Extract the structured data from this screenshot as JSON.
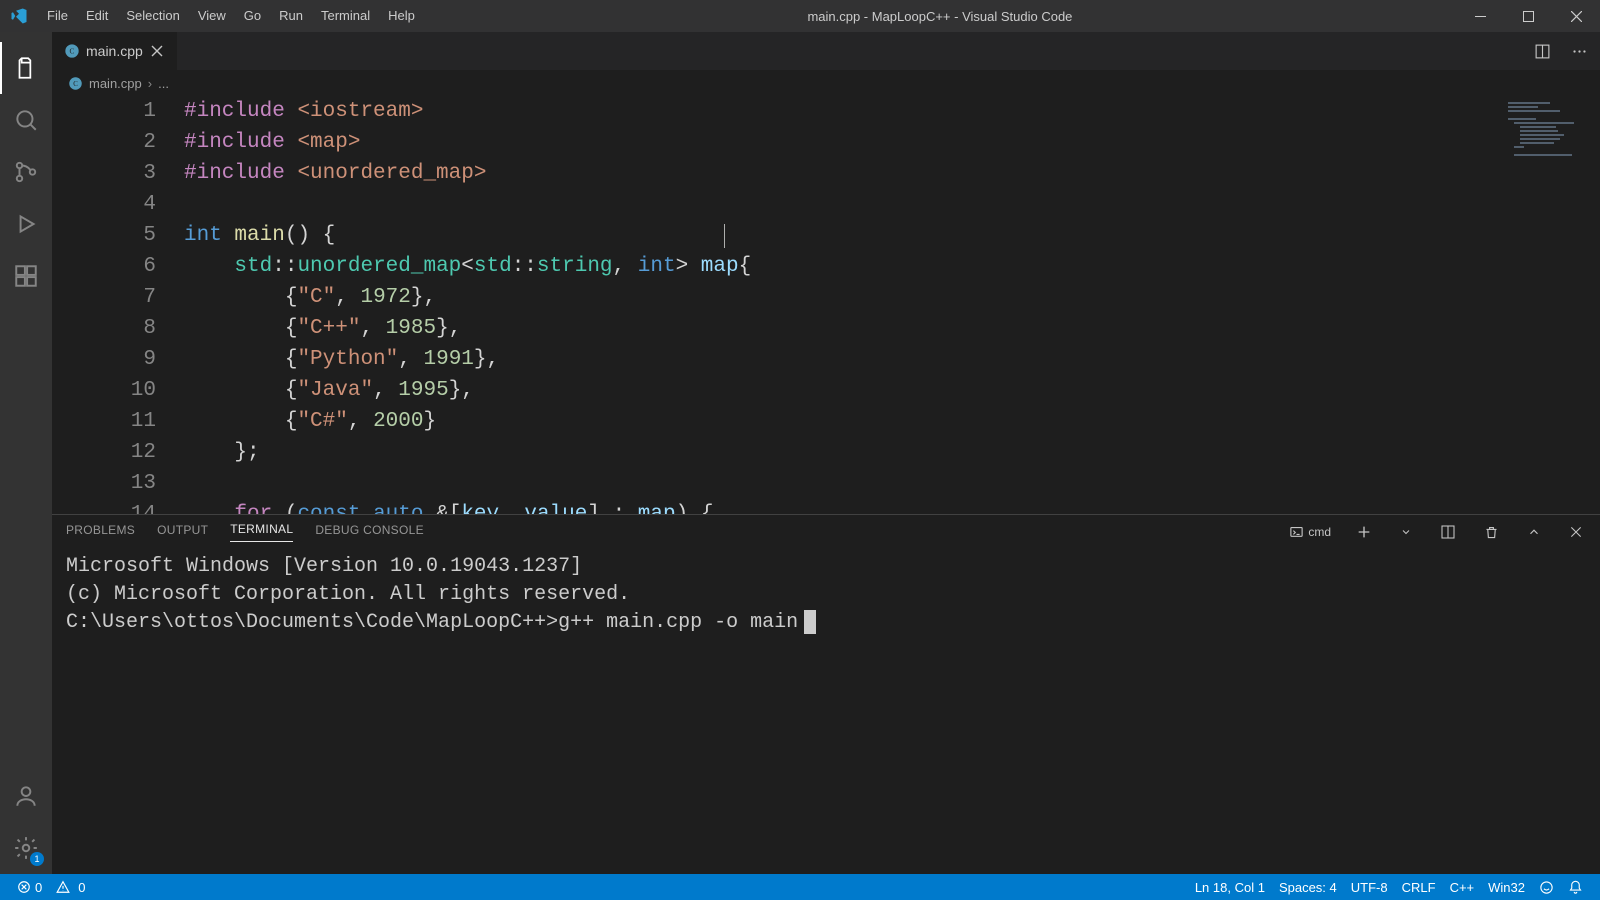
{
  "menu": [
    "File",
    "Edit",
    "Selection",
    "View",
    "Go",
    "Run",
    "Terminal",
    "Help"
  ],
  "title": "main.cpp - MapLoopC++ - Visual Studio Code",
  "tab": {
    "label": "main.cpp"
  },
  "breadcrumb": {
    "file": "main.cpp",
    "more": "..."
  },
  "code_lines": 14,
  "code": [
    [
      {
        "cls": "tok-directive",
        "t": "#include"
      },
      {
        "cls": "tok-plain",
        "t": " "
      },
      {
        "cls": "tok-angled",
        "t": "<iostream>"
      }
    ],
    [
      {
        "cls": "tok-directive",
        "t": "#include"
      },
      {
        "cls": "tok-plain",
        "t": " "
      },
      {
        "cls": "tok-angled",
        "t": "<map>"
      }
    ],
    [
      {
        "cls": "tok-directive",
        "t": "#include"
      },
      {
        "cls": "tok-plain",
        "t": " "
      },
      {
        "cls": "tok-angled",
        "t": "<unordered_map>"
      }
    ],
    [],
    [
      {
        "cls": "tok-type",
        "t": "int"
      },
      {
        "cls": "tok-plain",
        "t": " "
      },
      {
        "cls": "tok-func",
        "t": "main"
      },
      {
        "cls": "tok-punct",
        "t": "() {"
      }
    ],
    [
      {
        "cls": "tok-plain",
        "t": "    "
      },
      {
        "cls": "tok-ns",
        "t": "std"
      },
      {
        "cls": "tok-punct",
        "t": "::"
      },
      {
        "cls": "tok-ns",
        "t": "unordered_map"
      },
      {
        "cls": "tok-punct",
        "t": "<"
      },
      {
        "cls": "tok-ns",
        "t": "std"
      },
      {
        "cls": "tok-punct",
        "t": "::"
      },
      {
        "cls": "tok-ns",
        "t": "string"
      },
      {
        "cls": "tok-punct",
        "t": ", "
      },
      {
        "cls": "tok-type",
        "t": "int"
      },
      {
        "cls": "tok-punct",
        "t": "> "
      },
      {
        "cls": "tok-var",
        "t": "map"
      },
      {
        "cls": "tok-punct",
        "t": "{"
      }
    ],
    [
      {
        "cls": "tok-plain",
        "t": "        "
      },
      {
        "cls": "tok-punct",
        "t": "{"
      },
      {
        "cls": "tok-string",
        "t": "\"C\""
      },
      {
        "cls": "tok-punct",
        "t": ", "
      },
      {
        "cls": "tok-number",
        "t": "1972"
      },
      {
        "cls": "tok-punct",
        "t": "},"
      }
    ],
    [
      {
        "cls": "tok-plain",
        "t": "        "
      },
      {
        "cls": "tok-punct",
        "t": "{"
      },
      {
        "cls": "tok-string",
        "t": "\"C++\""
      },
      {
        "cls": "tok-punct",
        "t": ", "
      },
      {
        "cls": "tok-number",
        "t": "1985"
      },
      {
        "cls": "tok-punct",
        "t": "},"
      }
    ],
    [
      {
        "cls": "tok-plain",
        "t": "        "
      },
      {
        "cls": "tok-punct",
        "t": "{"
      },
      {
        "cls": "tok-string",
        "t": "\"Python\""
      },
      {
        "cls": "tok-punct",
        "t": ", "
      },
      {
        "cls": "tok-number",
        "t": "1991"
      },
      {
        "cls": "tok-punct",
        "t": "},"
      }
    ],
    [
      {
        "cls": "tok-plain",
        "t": "        "
      },
      {
        "cls": "tok-punct",
        "t": "{"
      },
      {
        "cls": "tok-string",
        "t": "\"Java\""
      },
      {
        "cls": "tok-punct",
        "t": ", "
      },
      {
        "cls": "tok-number",
        "t": "1995"
      },
      {
        "cls": "tok-punct",
        "t": "},"
      }
    ],
    [
      {
        "cls": "tok-plain",
        "t": "        "
      },
      {
        "cls": "tok-punct",
        "t": "{"
      },
      {
        "cls": "tok-string",
        "t": "\"C#\""
      },
      {
        "cls": "tok-punct",
        "t": ", "
      },
      {
        "cls": "tok-number",
        "t": "2000"
      },
      {
        "cls": "tok-punct",
        "t": "}"
      }
    ],
    [
      {
        "cls": "tok-plain",
        "t": "    "
      },
      {
        "cls": "tok-punct",
        "t": "};"
      }
    ],
    [],
    [
      {
        "cls": "tok-plain",
        "t": "    "
      },
      {
        "cls": "tok-keyword",
        "t": "for"
      },
      {
        "cls": "tok-plain",
        "t": " "
      },
      {
        "cls": "tok-punct",
        "t": "("
      },
      {
        "cls": "tok-kwblue",
        "t": "const"
      },
      {
        "cls": "tok-plain",
        "t": " "
      },
      {
        "cls": "tok-kwblue",
        "t": "auto"
      },
      {
        "cls": "tok-plain",
        "t": " "
      },
      {
        "cls": "tok-punct",
        "t": "&["
      },
      {
        "cls": "tok-var",
        "t": "key"
      },
      {
        "cls": "tok-punct",
        "t": ", "
      },
      {
        "cls": "tok-var",
        "t": "value"
      },
      {
        "cls": "tok-punct",
        "t": "] : "
      },
      {
        "cls": "tok-var",
        "t": "map"
      },
      {
        "cls": "tok-punct",
        "t": ") {"
      }
    ]
  ],
  "panel": {
    "tabs": [
      "PROBLEMS",
      "OUTPUT",
      "TERMINAL",
      "DEBUG CONSOLE"
    ],
    "active": 2,
    "term_label": "cmd",
    "lines": [
      "Microsoft Windows [Version 10.0.19043.1237]",
      "(c) Microsoft Corporation. All rights reserved.",
      "",
      "C:\\Users\\ottos\\Documents\\Code\\MapLoopC++>g++ main.cpp -o main"
    ]
  },
  "status": {
    "errors": "0",
    "warnings": "0",
    "ln_col": "Ln 18, Col 1",
    "spaces": "Spaces: 4",
    "encoding": "UTF-8",
    "eol": "CRLF",
    "lang": "C++",
    "target": "Win32"
  },
  "settings_badge": "1"
}
